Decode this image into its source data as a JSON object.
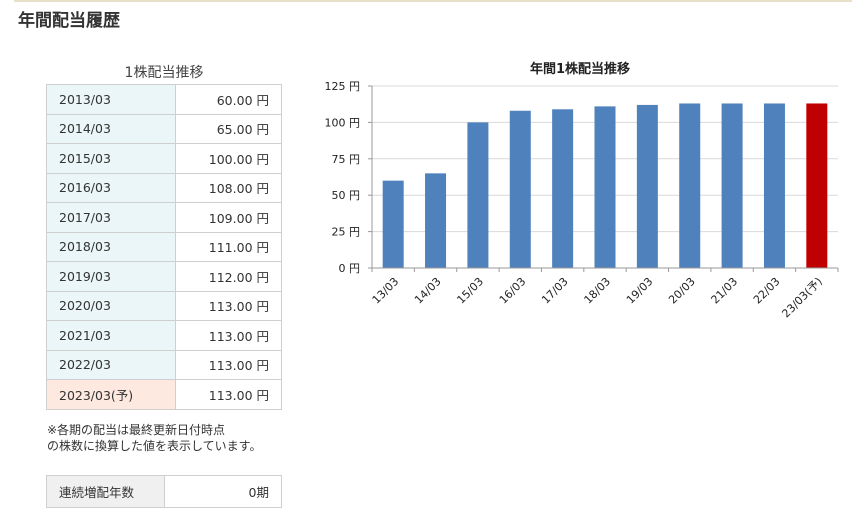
{
  "page": {
    "title": "年間配当履歴"
  },
  "table": {
    "caption": "1株配当推移",
    "rows": [
      {
        "period": "2013/03",
        "amount": "60.00 円"
      },
      {
        "period": "2014/03",
        "amount": "65.00 円"
      },
      {
        "period": "2015/03",
        "amount": "100.00 円"
      },
      {
        "period": "2016/03",
        "amount": "108.00 円"
      },
      {
        "period": "2017/03",
        "amount": "109.00 円"
      },
      {
        "period": "2018/03",
        "amount": "111.00 円"
      },
      {
        "period": "2019/03",
        "amount": "112.00 円"
      },
      {
        "period": "2020/03",
        "amount": "113.00 円"
      },
      {
        "period": "2021/03",
        "amount": "113.00 円"
      },
      {
        "period": "2022/03",
        "amount": "113.00 円"
      },
      {
        "period": "2023/03(予)",
        "amount": "113.00 円"
      }
    ],
    "note_line1": "※各期の配当は最終更新日付時点",
    "note_line2": "の株数に換算した値を表示しています。"
  },
  "streak": {
    "label": "連続増配年数",
    "value": "0期"
  },
  "chart_data": {
    "type": "bar",
    "title": "年間1株配当推移",
    "categories": [
      "13/03",
      "14/03",
      "15/03",
      "16/03",
      "17/03",
      "18/03",
      "19/03",
      "20/03",
      "21/03",
      "22/03",
      "23/03(予)"
    ],
    "values": [
      60,
      65,
      100,
      108,
      109,
      111,
      112,
      113,
      113,
      113,
      113
    ],
    "y_ticks": [
      "0 円",
      "25 円",
      "50 円",
      "75 円",
      "100 円",
      "125 円"
    ],
    "ylim": [
      0,
      125
    ],
    "grid": true,
    "colors": {
      "actual": "#4f81bd",
      "forecast": "#c00000",
      "grid": "#d9d9d9"
    },
    "forecast_index": 10
  }
}
